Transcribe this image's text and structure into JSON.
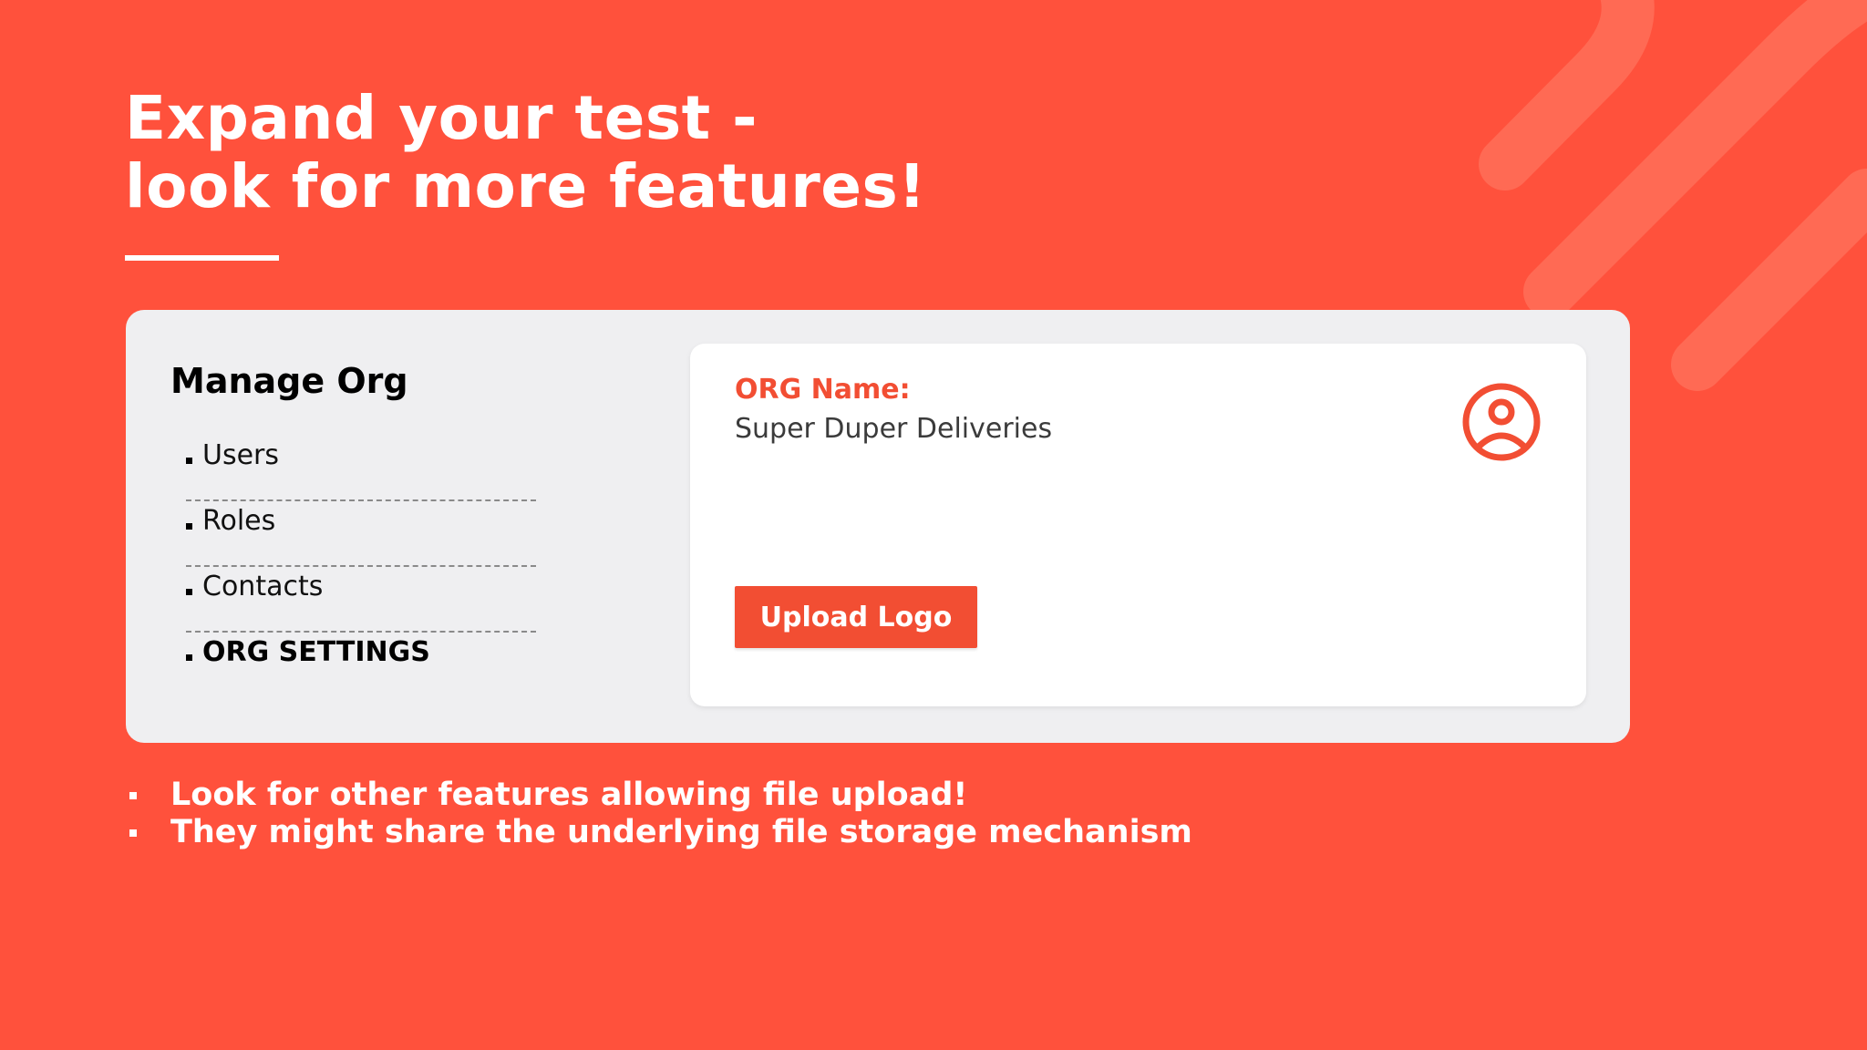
{
  "slide": {
    "title_lines": [
      "Expand your test -",
      "look for more features!"
    ],
    "background_color": "#FF513C",
    "accent_color": "#F24E33"
  },
  "panel": {
    "sidebar": {
      "title": "Manage Org",
      "items": [
        {
          "label": "Users",
          "active": false
        },
        {
          "label": "Roles",
          "active": false
        },
        {
          "label": "Contacts",
          "active": false
        },
        {
          "label": "ORG SETTINGS",
          "active": true
        }
      ]
    },
    "card": {
      "org_label": "ORG Name:",
      "org_value": "Super Duper Deliveries",
      "avatar_icon": "user-circle-icon",
      "upload_button_label": "Upload Logo"
    }
  },
  "notes": [
    "Look for other features allowing file upload!",
    "They might share the underlying file storage mechanism"
  ]
}
